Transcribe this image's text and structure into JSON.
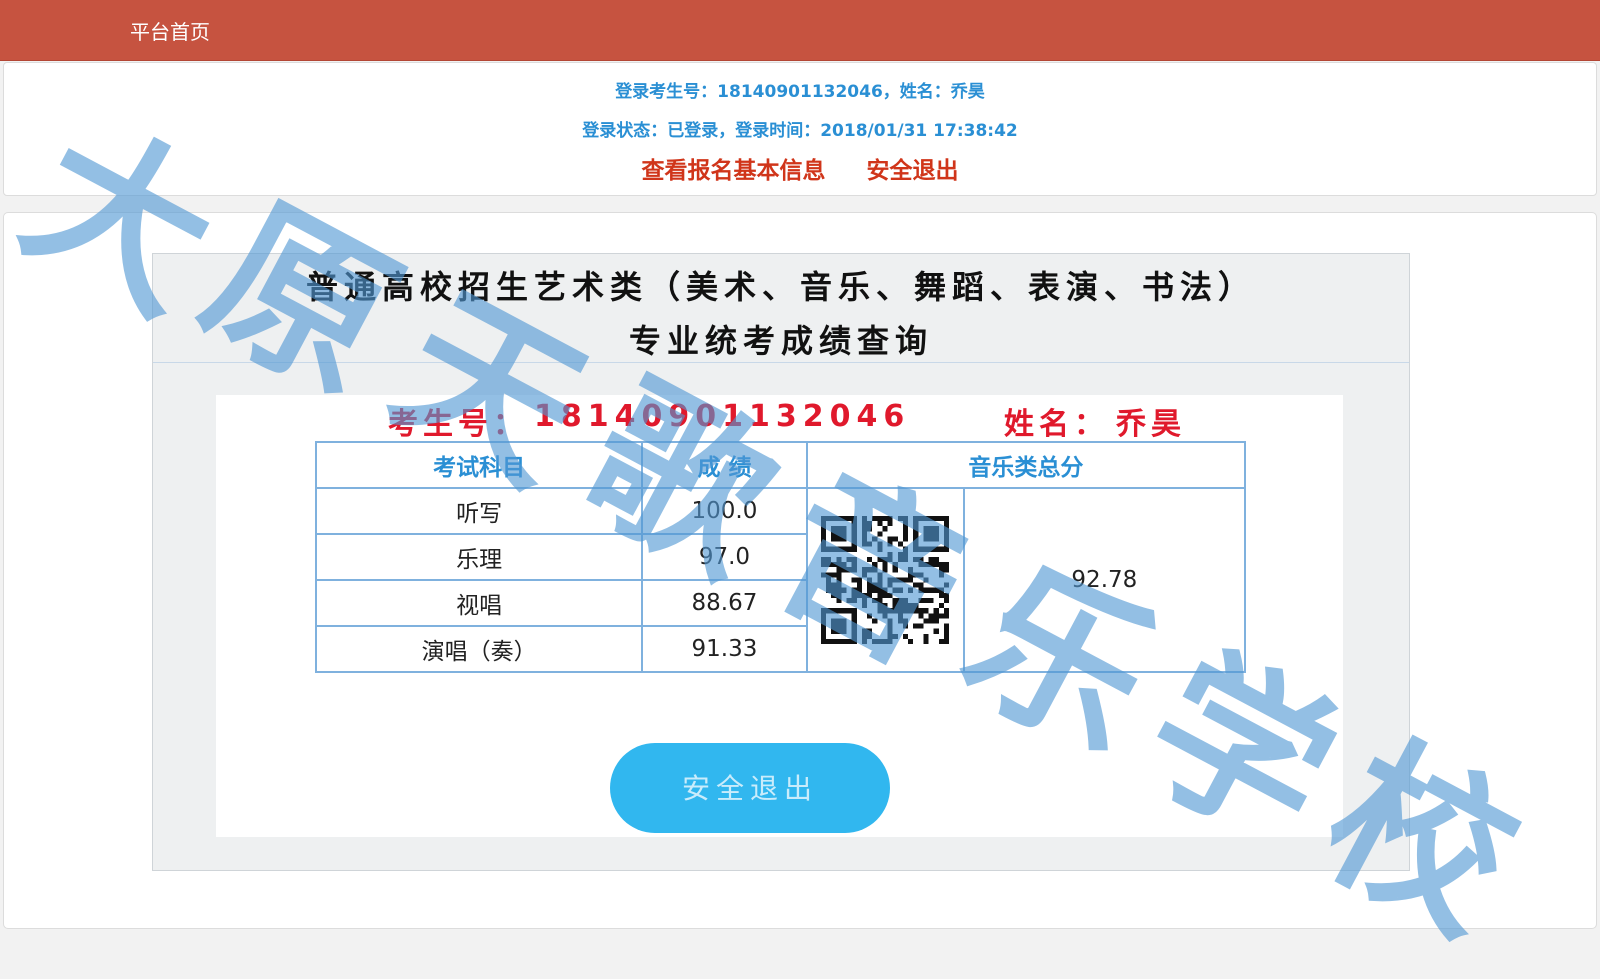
{
  "topbar": {
    "home_label": "平台首页"
  },
  "user": {
    "line1": "登录考生号：18140901132046，姓名：乔昊",
    "line2": "登录状态：已登录，登录时间：2018/01/31 17:38:42",
    "view_info_label": "查看报名基本信息",
    "logout_label": "安全退出"
  },
  "panel": {
    "title_line1": "普通高校招生艺术类（美术、音乐、舞蹈、表演、书法）",
    "title_line2": "专业统考成绩查询"
  },
  "result": {
    "id_label": "考生号：",
    "id_value": "18140901132046",
    "name_label": "姓名：",
    "name_value": "乔昊",
    "headers": {
      "subject": "考试科目",
      "score": "成 绩",
      "total": "音乐类总分"
    },
    "rows": [
      {
        "subject": "听写",
        "score": "100.0"
      },
      {
        "subject": "乐理",
        "score": "97.0"
      },
      {
        "subject": "视唱",
        "score": "88.67"
      },
      {
        "subject": "演唱（奏）",
        "score": "91.33"
      }
    ],
    "total_score": "92.78",
    "logout_button": "安全退出"
  },
  "watermark": {
    "chars": [
      "大",
      "原",
      "天",
      "歌",
      "音",
      "乐",
      "学",
      "校"
    ]
  },
  "colors": {
    "topbar": "#c65340",
    "link_blue": "#2a8fd4",
    "link_red": "#d0351a",
    "id_red": "#e0192c",
    "button": "#31b7ef",
    "table_border": "#7fb1de"
  }
}
